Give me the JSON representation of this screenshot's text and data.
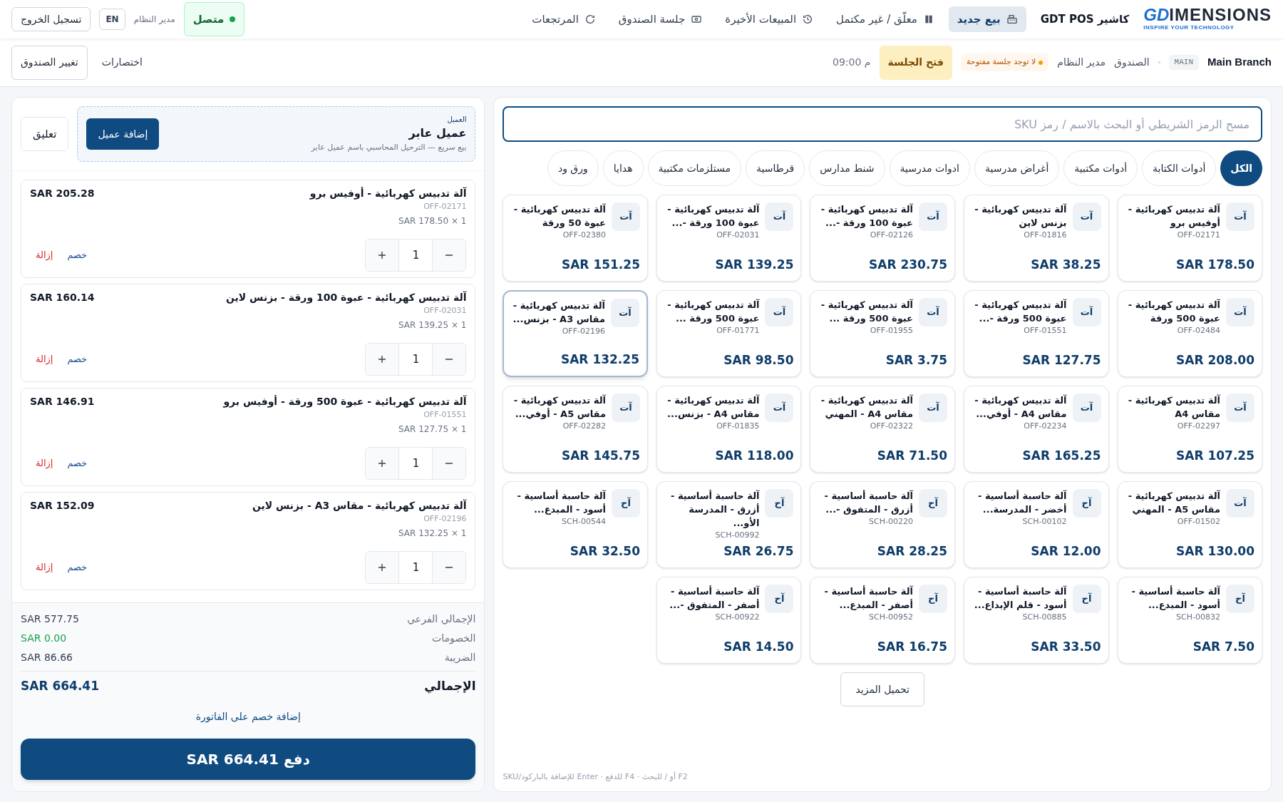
{
  "header": {
    "logo": {
      "mark": "GD",
      "word": "IMENSIONS",
      "tagline": "INSPIRE YOUR TECHNOLOGY"
    },
    "app_title": "كاشير GDT POS",
    "nav": [
      {
        "label": "بيع جديد",
        "kind": "register",
        "selected": true
      },
      {
        "label": "معلّق / غير مكتمل",
        "kind": "pause",
        "selected": false
      },
      {
        "label": "المبيعات الأخيرة",
        "kind": "history",
        "selected": false
      },
      {
        "label": "جلسة الصندوق",
        "kind": "cash",
        "selected": false
      },
      {
        "label": "المرتجعات",
        "kind": "undo",
        "selected": false
      }
    ],
    "status": {
      "label": "متصل",
      "online": true
    },
    "user": "مدير النظام",
    "language": "EN",
    "logout": "تسجيل الخروج"
  },
  "session_bar": {
    "branch": "Main Branch",
    "branch_code": "MAIN",
    "register": "الصندوق",
    "user": "مدير النظام",
    "session_badge": "لا توجد جلسة مفتوحة",
    "open_button": "فتح الجلسة",
    "time": "09:00 م",
    "shortcuts": "اختصارات",
    "change_register": "تغيير الصندوق"
  },
  "catalog": {
    "search": {
      "placeholder": "مسح الرمز الشريطي أو البحث بالاسم / رمز SKU"
    },
    "categories": [
      {
        "label": "الكل",
        "selected": true
      },
      {
        "label": "أدوات الكتابة",
        "selected": false
      },
      {
        "label": "أدوات مكتبية",
        "selected": false
      },
      {
        "label": "أغراض مدرسية",
        "selected": false
      },
      {
        "label": "ادوات مدرسية",
        "selected": false
      },
      {
        "label": "شنط مدارس",
        "selected": false
      },
      {
        "label": "قرطاسية",
        "selected": false
      },
      {
        "label": "مستلزمات مكتبية",
        "selected": false
      },
      {
        "label": "هدايا",
        "selected": false
      },
      {
        "label": "ورق ود",
        "selected": false
      }
    ],
    "products": [
      {
        "initials": "آت",
        "name": "آلة تدبيس كهربائية - أوفيس برو",
        "sku": "OFF-02171",
        "price": "SAR 178.50",
        "selected": false
      },
      {
        "initials": "آت",
        "name": "آلة تدبيس كهربائية - بزنس لاين",
        "sku": "OFF-01816",
        "price": "SAR 38.25",
        "selected": false
      },
      {
        "initials": "آت",
        "name": "آلة تدبيس كهربائية - عبوة 100 ورقة -...",
        "sku": "OFF-02126",
        "price": "SAR 230.75",
        "selected": false
      },
      {
        "initials": "آت",
        "name": "آلة تدبيس كهربائية - عبوة 100 ورقة -...",
        "sku": "OFF-02031",
        "price": "SAR 139.25",
        "selected": false
      },
      {
        "initials": "آت",
        "name": "آلة تدبيس كهربائية - عبوة 50 ورقة",
        "sku": "OFF-02380",
        "price": "SAR 151.25",
        "selected": false
      },
      {
        "initials": "آت",
        "name": "آلة تدبيس كهربائية - عبوة 500 ورقة",
        "sku": "OFF-02484",
        "price": "SAR 208.00",
        "selected": false
      },
      {
        "initials": "آت",
        "name": "آلة تدبيس كهربائية - عبوة 500 ورقة -...",
        "sku": "OFF-01551",
        "price": "SAR 127.75",
        "selected": false
      },
      {
        "initials": "آت",
        "name": "آلة تدبيس كهربائية - عبوة 500 ورقة ...",
        "sku": "OFF-01955",
        "price": "SAR 3.75",
        "selected": false
      },
      {
        "initials": "آت",
        "name": "آلة تدبيس كهربائية - عبوة 500 ورقة ...",
        "sku": "OFF-01771",
        "price": "SAR 98.50",
        "selected": false
      },
      {
        "initials": "آت",
        "name": "آلة تدبيس كهربائية - مقاس A3 - بزنس...",
        "sku": "OFF-02196",
        "price": "SAR 132.25",
        "selected": true
      },
      {
        "initials": "آت",
        "name": "آلة تدبيس كهربائية - مقاس A4",
        "sku": "OFF-02297",
        "price": "SAR 107.25",
        "selected": false
      },
      {
        "initials": "آت",
        "name": "آلة تدبيس كهربائية - مقاس A4 - أوفي...",
        "sku": "OFF-02234",
        "price": "SAR 165.25",
        "selected": false
      },
      {
        "initials": "آت",
        "name": "آلة تدبيس كهربائية - مقاس A4 - المهني",
        "sku": "OFF-02322",
        "price": "SAR 71.50",
        "selected": false
      },
      {
        "initials": "آت",
        "name": "آلة تدبيس كهربائية - مقاس A4 - بزنس...",
        "sku": "OFF-01835",
        "price": "SAR 118.00",
        "selected": false
      },
      {
        "initials": "آت",
        "name": "آلة تدبيس كهربائية - مقاس A5 - أوفي...",
        "sku": "OFF-02282",
        "price": "SAR 145.75",
        "selected": false
      },
      {
        "initials": "آت",
        "name": "آلة تدبيس كهربائية - مقاس A5 - المهني",
        "sku": "OFF-01502",
        "price": "SAR 130.00",
        "selected": false
      },
      {
        "initials": "آح",
        "name": "آلة حاسبة أساسية - أخضر - المدرسة...",
        "sku": "SCH-00102",
        "price": "SAR 12.00",
        "selected": false
      },
      {
        "initials": "آح",
        "name": "آلة حاسبة أساسية - أزرق - المتفوق -...",
        "sku": "SCH-00220",
        "price": "SAR 28.25",
        "selected": false
      },
      {
        "initials": "آح",
        "name": "آلة حاسبة أساسية - أزرق - المدرسة الأو...",
        "sku": "SCH-00992",
        "price": "SAR 26.75",
        "selected": false
      },
      {
        "initials": "آح",
        "name": "آلة حاسبة أساسية - أسود - المبدع...",
        "sku": "SCH-00544",
        "price": "SAR 32.50",
        "selected": false
      },
      {
        "initials": "آح",
        "name": "آلة حاسبة أساسية - أسود - المبدع...",
        "sku": "SCH-00832",
        "price": "SAR 7.50",
        "selected": false
      },
      {
        "initials": "آح",
        "name": "آلة حاسبة أساسية - أسود - قلم الإبداع...",
        "sku": "SCH-00885",
        "price": "SAR 33.50",
        "selected": false
      },
      {
        "initials": "آح",
        "name": "آلة حاسبة أساسية - أصفر - المبدع...",
        "sku": "SCH-00952",
        "price": "SAR 16.75",
        "selected": false
      },
      {
        "initials": "آح",
        "name": "آلة حاسبة أساسية - أصفر - المتفوق -...",
        "sku": "SCH-00922",
        "price": "SAR 14.50",
        "selected": false
      }
    ],
    "load_more": "تحميل المزيد",
    "hint": "F2 أو / للبحث · F4 للدفع · Enter للإضافة بالباركود/SKU"
  },
  "cart": {
    "customer": {
      "label": "العميل",
      "name": "عميل عابر",
      "note": "بيع سريع — الترحيل المحاسبي باسم عميل عابر",
      "add_button": "إضافة عميل"
    },
    "hold_button": "تعليق",
    "items": [
      {
        "name": "آلة تدبيس كهربائية - أوفيس برو",
        "sku": "OFF-02171",
        "unit": "SAR 178.50 × 1",
        "qty": "1",
        "total": "SAR 205.28",
        "discount": "خصم",
        "remove": "إزالة"
      },
      {
        "name": "آلة تدبيس كهربائية - عبوة 100 ورقة - بزنس لاين",
        "sku": "OFF-02031",
        "unit": "SAR 139.25 × 1",
        "qty": "1",
        "total": "SAR 160.14",
        "discount": "خصم",
        "remove": "إزالة"
      },
      {
        "name": "آلة تدبيس كهربائية - عبوة 500 ورقة - أوفيس برو",
        "sku": "OFF-01551",
        "unit": "SAR 127.75 × 1",
        "qty": "1",
        "total": "SAR 146.91",
        "discount": "خصم",
        "remove": "إزالة"
      },
      {
        "name": "آلة تدبيس كهربائية - مقاس A3 - بزنس لاين",
        "sku": "OFF-02196",
        "unit": "SAR 132.25 × 1",
        "qty": "1",
        "total": "SAR 152.09",
        "discount": "خصم",
        "remove": "إزالة"
      }
    ],
    "totals": [
      {
        "label": "الإجمالي الفرعي",
        "value": "SAR 577.75",
        "kind": "plain"
      },
      {
        "label": "الخصومات",
        "value": "SAR 0.00",
        "kind": "discount"
      },
      {
        "label": "الضريبة",
        "value": "SAR 86.66",
        "kind": "plain"
      }
    ],
    "grand_total": {
      "label": "الإجمالي",
      "value": "SAR 664.41"
    },
    "invoice_discount": "إضافة خصم على الفاتورة",
    "pay_button": "دفع SAR 664.41"
  }
}
